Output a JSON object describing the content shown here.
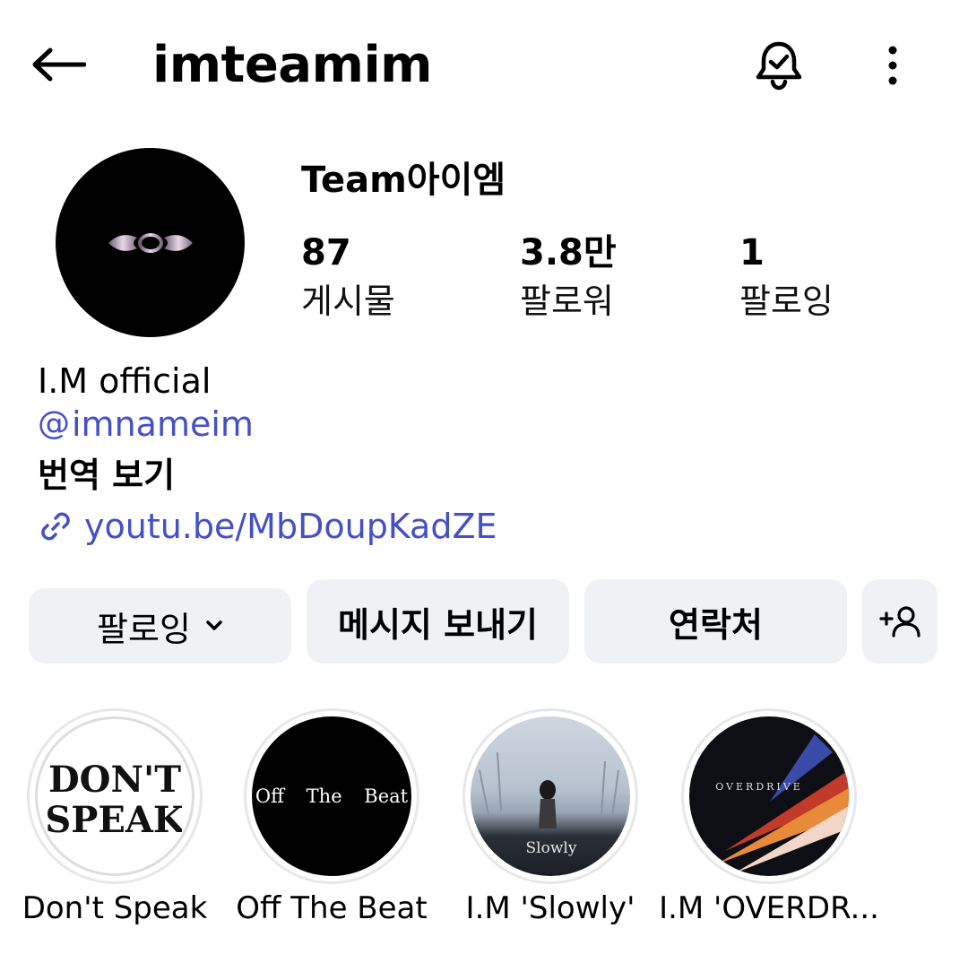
{
  "header": {
    "username": "imteamim",
    "icons": {
      "back": "arrow-left-icon",
      "notifications": "bell-check-icon",
      "more": "more-vertical-icon"
    }
  },
  "profile": {
    "display_name": "Team아이엠",
    "stats": [
      {
        "value": "87",
        "label": "게시물"
      },
      {
        "value": "3.8만",
        "label": "팔로워"
      },
      {
        "value": "1",
        "label": "팔로잉"
      }
    ],
    "bio_name": "I.M official",
    "threads_handle": "imnameim",
    "translate_label": "번역 보기",
    "website": "youtu.be/MbDoupKadZE",
    "link_color": "#4350c7"
  },
  "actions": {
    "following": "팔로잉",
    "message": "메시지 보내기",
    "contact": "연락처",
    "add_user_icon": "add-user-icon",
    "button_bg": "#eff1f5"
  },
  "highlights": [
    {
      "title": "Don't Speak",
      "cover_text": "DON'T SPEAK"
    },
    {
      "title": "Off The Beat",
      "cover_text": "Off The Beat"
    },
    {
      "title": "I.M 'Slowly'",
      "cover_text": "Slowly"
    },
    {
      "title": "I.M 'OVERDR...",
      "cover_text": "OVERDRIVE"
    }
  ]
}
